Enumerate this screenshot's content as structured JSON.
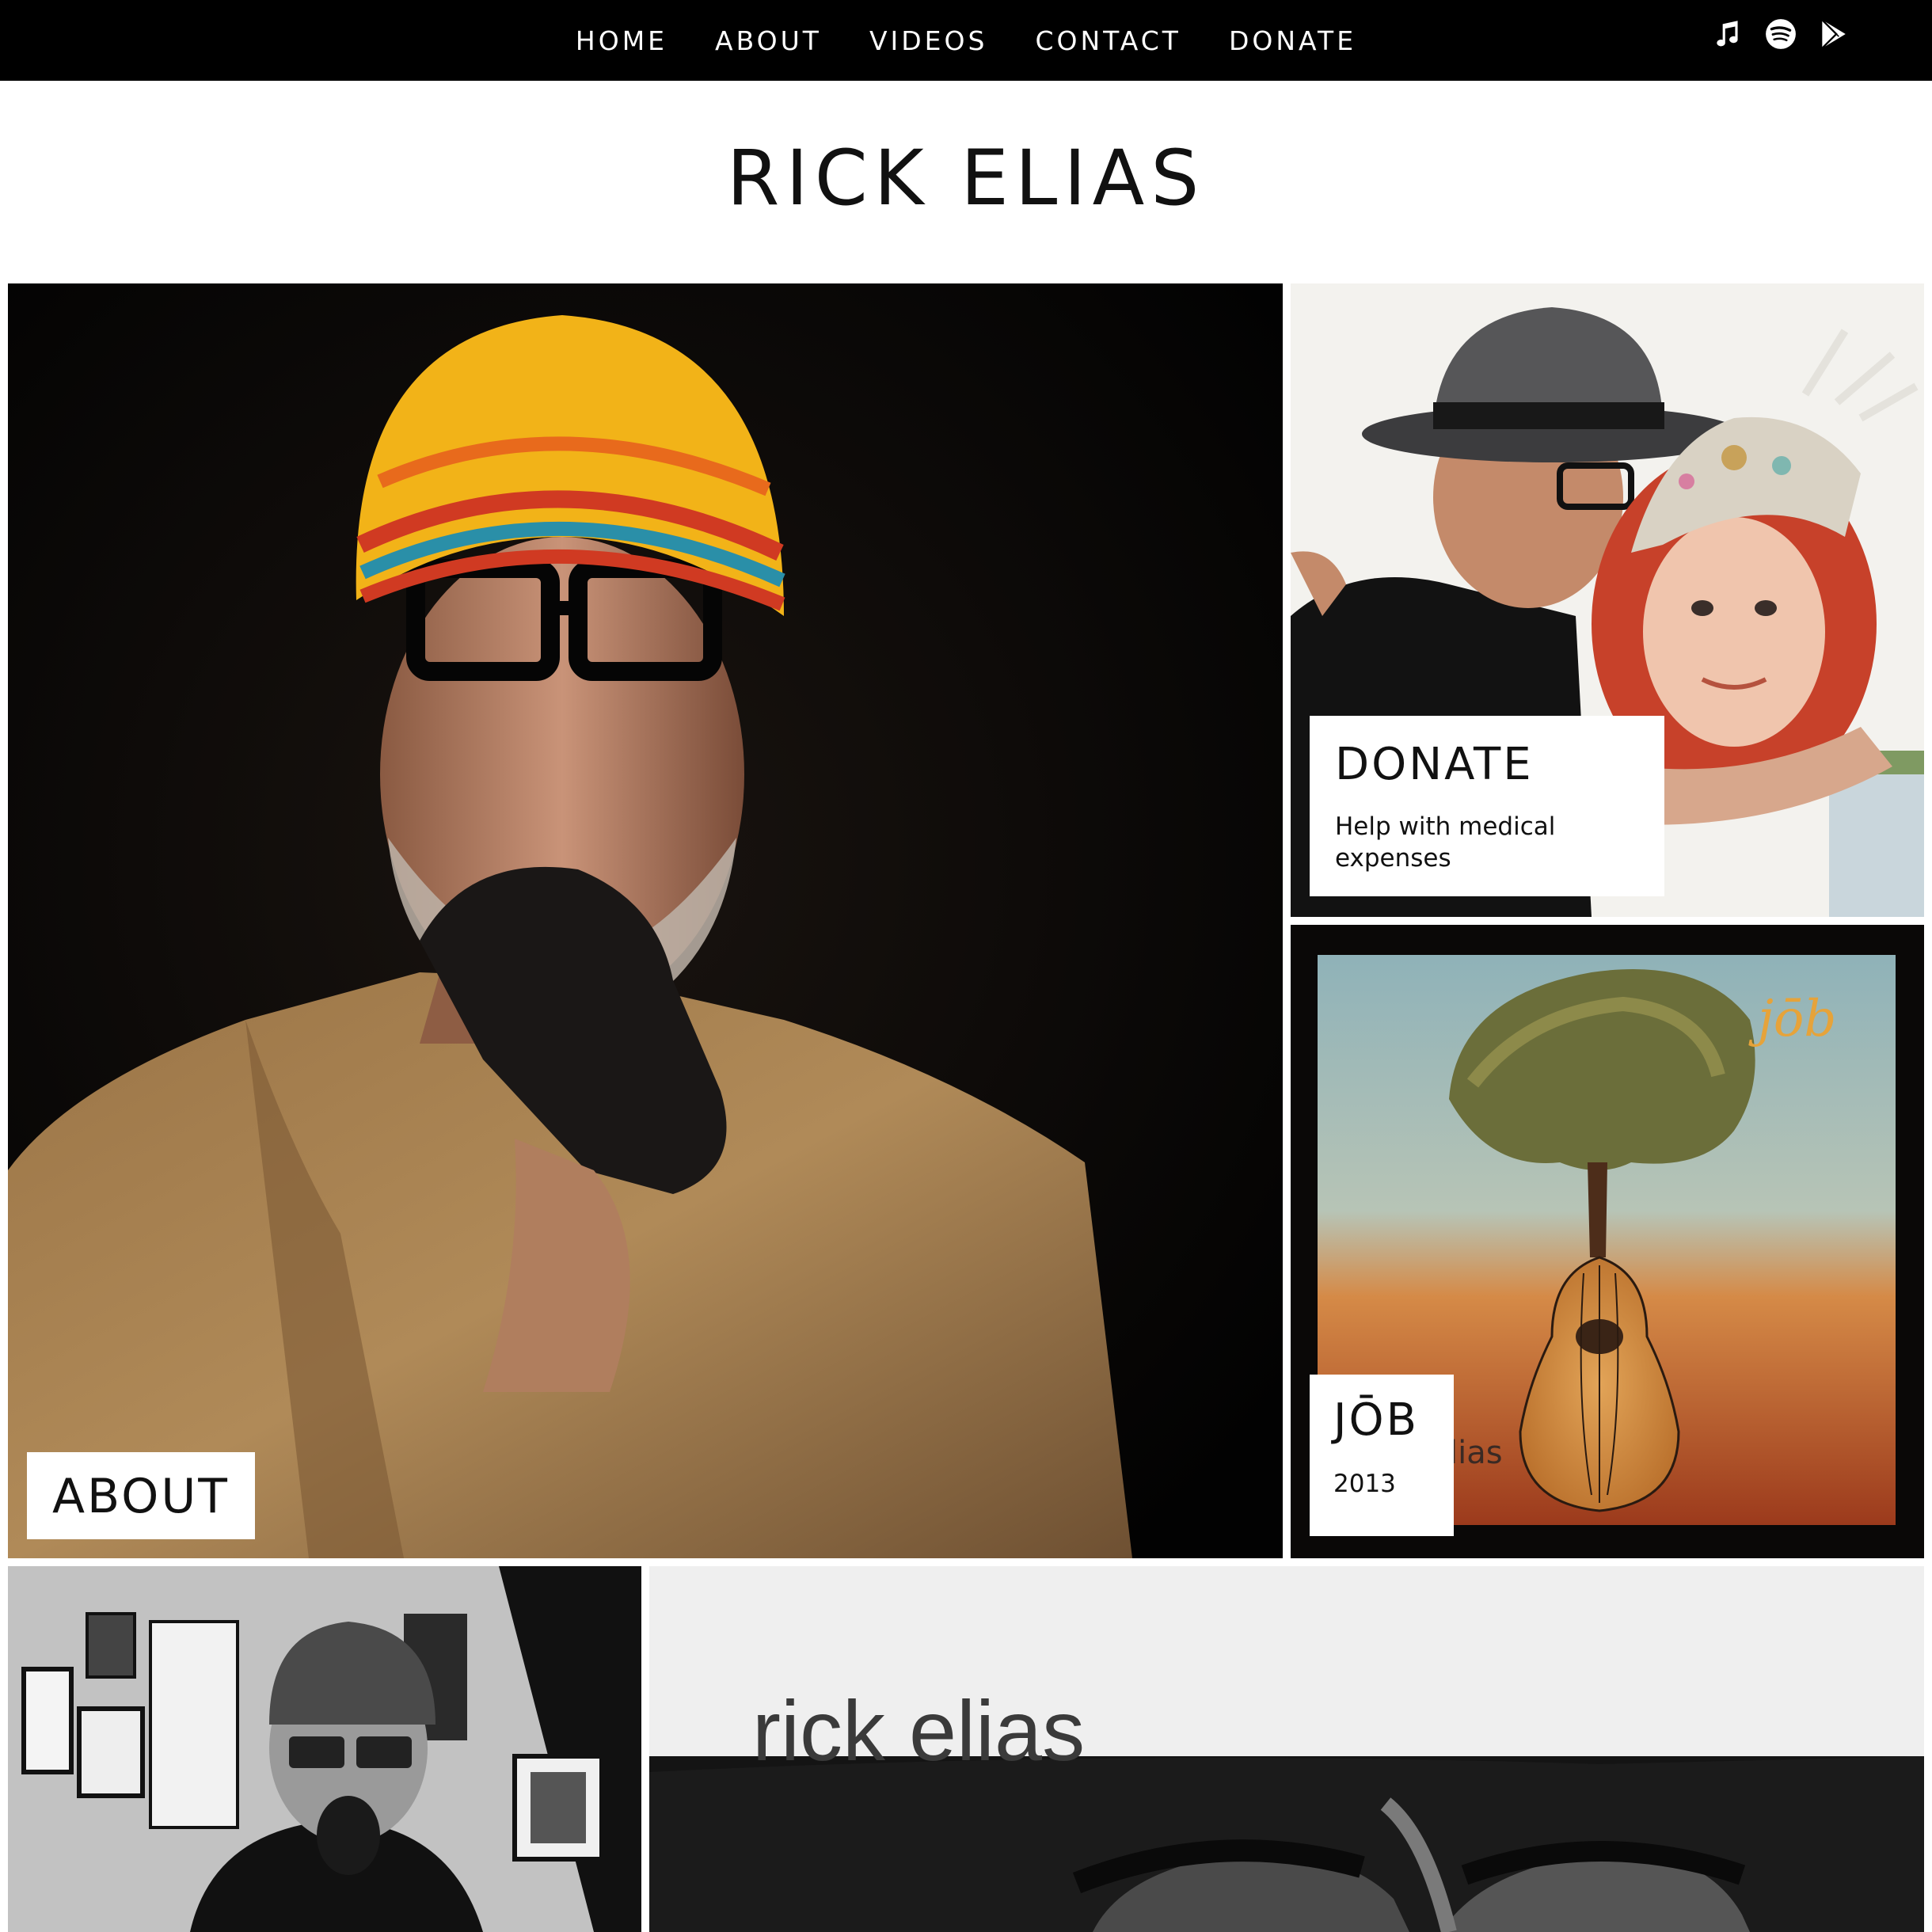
{
  "nav": {
    "items": [
      {
        "label": "HOME"
      },
      {
        "label": "ABOUT"
      },
      {
        "label": "VIDEOS"
      },
      {
        "label": "CONTACT"
      },
      {
        "label": "DONATE"
      }
    ],
    "social_icons": [
      "itunes-music-note-icon",
      "spotify-icon",
      "google-play-icon"
    ]
  },
  "site": {
    "title": "RICK ELIAS"
  },
  "tiles": {
    "about": {
      "title": "ABOUT"
    },
    "donate": {
      "title": "DONATE",
      "subtitle": "Help with medical expenses"
    },
    "job": {
      "title": "JŌB",
      "subtitle": "2013",
      "art_lettering": "jōb",
      "art_lettering_2": "lias"
    },
    "album": {
      "art_lettering": "rick elias"
    }
  },
  "colors": {
    "nav_background": "#000000",
    "nav_text": "#ffffff",
    "page_background": "#ffffff",
    "label_background": "#ffffff",
    "label_text": "#111111"
  }
}
